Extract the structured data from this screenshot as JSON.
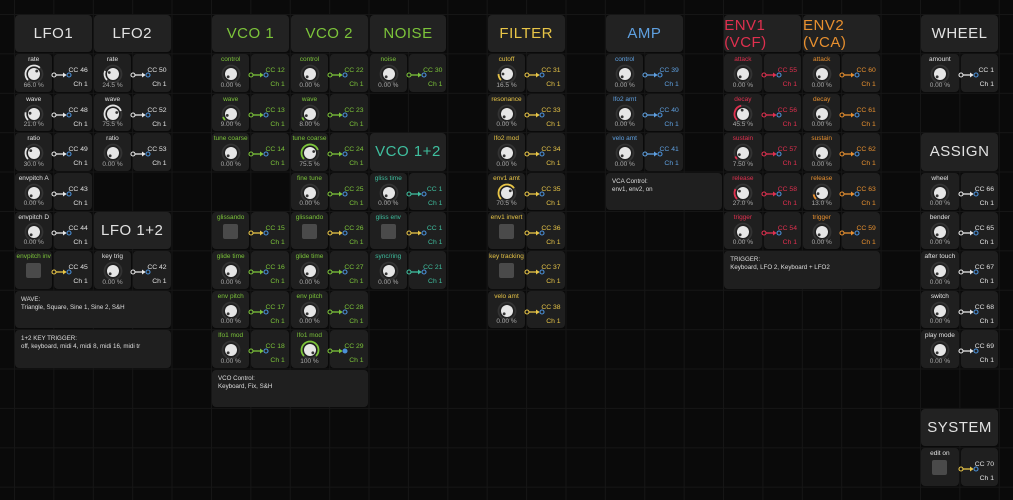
{
  "sections": {
    "lfo": {
      "color": "#e2e2e2",
      "headers": [
        {
          "title": "LFO1"
        },
        {
          "title": "LFO2"
        },
        {
          "title": "LFO 1+2"
        }
      ],
      "controls": [
        {
          "label": "rate",
          "type": "knob",
          "value": "66.0 %",
          "level": 0.66,
          "cc": "CC 46",
          "ch": "Ch 1"
        },
        {
          "label": "rate",
          "type": "knob",
          "value": "24.5 %",
          "level": 0.245,
          "cc": "CC 50",
          "ch": "Ch 1"
        },
        {
          "label": "wave",
          "type": "knob",
          "value": "21.0 %",
          "level": 0.21,
          "cc": "CC 48",
          "ch": "Ch 1"
        },
        {
          "label": "wave",
          "type": "knob",
          "value": "75.5 %",
          "level": 0.755,
          "cc": "CC 52",
          "ch": "Ch 1"
        },
        {
          "label": "ratio",
          "type": "knob",
          "value": "30.0 %",
          "level": 0.3,
          "cc": "CC 49",
          "ch": "Ch 1"
        },
        {
          "label": "ratio",
          "type": "knob",
          "value": "0.00 %",
          "level": 0,
          "cc": "CC 53",
          "ch": "Ch 1"
        },
        {
          "label": "envpitch A",
          "type": "knob",
          "value": "0.00 %",
          "level": 0,
          "cc": "CC 43",
          "ch": "Ch 1"
        },
        {
          "label": "envpitch D",
          "type": "knob",
          "value": "0.00 %",
          "level": 0,
          "cc": "CC 44",
          "ch": "Ch 1"
        },
        {
          "label": "envpitch inv",
          "type": "toggle",
          "label_color": "#7cc43a",
          "cc": "CC 45",
          "ch": "Ch 1"
        },
        {
          "label": "key trig",
          "type": "knob",
          "value": "0.00 %",
          "level": 0,
          "cc": "CC 42",
          "ch": "Ch 1"
        }
      ],
      "notes": [
        {
          "title": "WAVE:",
          "body": "Triangle, Square, Sine 1, Sine 2, S&H"
        },
        {
          "title": "1+2 KEY TRIGGER:",
          "body": "off, keyboard, midi 4, midi 8, midi 16, midi tr"
        }
      ]
    },
    "vco": {
      "color": "#7cc43a",
      "headers": [
        {
          "title": "VCO 1"
        },
        {
          "title": "VCO 2"
        },
        {
          "title": "NOISE"
        },
        {
          "title": "VCO 1+2",
          "color": "#3fbf9f"
        }
      ],
      "controls": [
        {
          "label": "control",
          "type": "knob",
          "value": "0.00 %",
          "level": 0,
          "cc": "CC 12",
          "ch": "Ch 1"
        },
        {
          "label": "control",
          "type": "knob",
          "value": "0.00 %",
          "level": 0,
          "cc": "CC 22",
          "ch": "Ch 1"
        },
        {
          "label": "noise",
          "type": "knob",
          "value": "0.00 %",
          "level": 0,
          "cc": "CC 30",
          "ch": "Ch 1"
        },
        {
          "label": "wave",
          "type": "knob",
          "value": "9.00 %",
          "level": 0.09,
          "cc": "CC 13",
          "ch": "Ch 1"
        },
        {
          "label": "wave",
          "type": "knob",
          "value": "8.00 %",
          "level": 0.08,
          "cc": "CC 23",
          "ch": "Ch 1"
        },
        {
          "label": "tune coarse",
          "type": "knob",
          "value": "0.00 %",
          "level": 0,
          "cc": "CC 14",
          "ch": "Ch 1"
        },
        {
          "label": "tune coarse",
          "type": "knob",
          "value": "75.5 %",
          "level": 0.755,
          "cc": "CC 24",
          "ch": "Ch 1"
        },
        {
          "label": "fine tune",
          "type": "knob",
          "value": "0.00 %",
          "level": 0,
          "cc": "CC 25",
          "ch": "Ch 1"
        },
        {
          "label": "gliss time",
          "type": "knob",
          "value": "0.00 %",
          "level": 0,
          "cc": "CC 1",
          "ch": "Ch 1",
          "color": "#3fbf9f"
        },
        {
          "label": "glissando",
          "type": "toggle",
          "cc": "CC 15",
          "ch": "Ch 1"
        },
        {
          "label": "glissando",
          "type": "toggle",
          "cc": "CC 26",
          "ch": "Ch 1"
        },
        {
          "label": "gliss env",
          "type": "toggle",
          "cc": "CC 1",
          "ch": "Ch 1",
          "color": "#3fbf9f"
        },
        {
          "label": "glide time",
          "type": "knob",
          "value": "0.00 %",
          "level": 0,
          "cc": "CC 16",
          "ch": "Ch 1"
        },
        {
          "label": "glide time",
          "type": "knob",
          "value": "0.00 %",
          "level": 0,
          "cc": "CC 27",
          "ch": "Ch 1"
        },
        {
          "label": "sync/ring",
          "type": "knob",
          "value": "0.00 %",
          "level": 0,
          "cc": "CC 21",
          "ch": "Ch 1",
          "color": "#3fbf9f"
        },
        {
          "label": "env pitch",
          "type": "knob",
          "value": "0.00 %",
          "level": 0,
          "cc": "CC 17",
          "ch": "Ch 1"
        },
        {
          "label": "env pitch",
          "type": "knob",
          "value": "0.00 %",
          "level": 0,
          "cc": "CC 28",
          "ch": "Ch 1"
        },
        {
          "label": "lfo1 mod",
          "type": "knob",
          "value": "0.00 %",
          "level": 0,
          "cc": "CC 18",
          "ch": "Ch 1"
        },
        {
          "label": "lfo1 mod",
          "type": "knob",
          "value": "100 %",
          "level": 1,
          "cc": "CC 29",
          "ch": "Ch 1"
        }
      ],
      "notes": [
        {
          "title": "VCO Control:",
          "body": "Keyboard, Fix, S&H"
        }
      ]
    },
    "filter": {
      "color": "#e8c547",
      "headers": [
        {
          "title": "FILTER"
        }
      ],
      "controls": [
        {
          "label": "cutoff",
          "type": "knob",
          "value": "16.5 %",
          "level": 0.165,
          "cc": "CC 31",
          "ch": "Ch 1"
        },
        {
          "label": "resonance",
          "type": "knob",
          "value": "0.00 %",
          "level": 0,
          "cc": "CC 33",
          "ch": "Ch 1"
        },
        {
          "label": "lfo2 mod",
          "type": "knob",
          "value": "0.00 %",
          "level": 0,
          "cc": "CC 34",
          "ch": "Ch 1"
        },
        {
          "label": "env1 amt",
          "type": "knob",
          "value": "70.5 %",
          "level": 0.705,
          "cc": "CC 35",
          "ch": "Ch 1"
        },
        {
          "label": "env1 invert",
          "type": "toggle",
          "cc": "CC 36",
          "ch": "Ch 1"
        },
        {
          "label": "key tracking",
          "type": "toggle",
          "cc": "CC 37",
          "ch": "Ch 1"
        },
        {
          "label": "velo amt",
          "type": "knob",
          "value": "0.00 %",
          "level": 0,
          "cc": "CC 38",
          "ch": "Ch 1"
        }
      ],
      "notes": []
    },
    "amp": {
      "color": "#5fa0e0",
      "headers": [
        {
          "title": "AMP"
        }
      ],
      "controls": [
        {
          "label": "control",
          "type": "knob",
          "value": "0.00 %",
          "level": 0,
          "cc": "CC 39",
          "ch": "Ch 1"
        },
        {
          "label": "lfo2 amt",
          "type": "knob",
          "value": "0.00 %",
          "level": 0,
          "cc": "CC 40",
          "ch": "Ch 1"
        },
        {
          "label": "velo amt",
          "type": "knob",
          "value": "0.00 %",
          "level": 0,
          "cc": "CC 41",
          "ch": "Ch 1"
        }
      ],
      "notes": [
        {
          "title": "VCA Control:",
          "body": "env1, env2, on"
        }
      ]
    },
    "env": {
      "color": "#e0304f",
      "headers": [
        {
          "title": "ENV1 (VCF)"
        },
        {
          "title": "ENV2 (VCA)",
          "color": "#e8902f"
        }
      ],
      "controls": [
        {
          "label": "attack",
          "type": "knob",
          "value": "0.00 %",
          "level": 0,
          "cc": "CC 55",
          "ch": "Ch 1"
        },
        {
          "label": "attack",
          "type": "knob",
          "value": "0.00 %",
          "level": 0,
          "cc": "CC 60",
          "ch": "Ch 1",
          "color": "#e8902f"
        },
        {
          "label": "decay",
          "type": "knob",
          "value": "45.5 %",
          "level": 0.455,
          "cc": "CC 56",
          "ch": "Ch 1"
        },
        {
          "label": "decay",
          "type": "knob",
          "value": "0.00 %",
          "level": 0,
          "cc": "CC 61",
          "ch": "Ch 1",
          "color": "#e8902f"
        },
        {
          "label": "sustain",
          "type": "knob",
          "value": "7.50 %",
          "level": 0.075,
          "cc": "CC 57",
          "ch": "Ch 1"
        },
        {
          "label": "sustain",
          "type": "knob",
          "value": "0.00 %",
          "level": 0,
          "cc": "CC 62",
          "ch": "Ch 1",
          "color": "#e8902f"
        },
        {
          "label": "release",
          "type": "knob",
          "value": "27.0 %",
          "level": 0.27,
          "cc": "CC 58",
          "ch": "Ch 1"
        },
        {
          "label": "release",
          "type": "knob",
          "value": "13.0 %",
          "level": 0.13,
          "cc": "CC 63",
          "ch": "Ch 1",
          "color": "#e8902f"
        },
        {
          "label": "trigger",
          "type": "knob",
          "value": "0.00 %",
          "level": 0,
          "cc": "CC 54",
          "ch": "Ch 1"
        },
        {
          "label": "trigger",
          "type": "knob",
          "value": "0.00 %",
          "level": 0,
          "cc": "CC 59",
          "ch": "Ch 1",
          "color": "#e8902f"
        }
      ],
      "notes": [
        {
          "title": "TRIGGER:",
          "body": "Keyboard, LFO 2, Keyboard + LFO2"
        }
      ]
    },
    "wheel": {
      "color": "#e2e2e2",
      "headers": [
        {
          "title": "WHEEL"
        },
        {
          "title": "ASSIGN"
        },
        {
          "title": "SYSTEM"
        }
      ],
      "controls": [
        {
          "label": "amount",
          "type": "knob",
          "value": "0.00 %",
          "level": 0,
          "cc": "CC 1",
          "ch": "Ch 1"
        },
        {
          "label": "wheel",
          "type": "knob",
          "value": "0.00 %",
          "level": 0,
          "cc": "CC 66",
          "ch": "Ch 1"
        },
        {
          "label": "bender",
          "type": "knob",
          "value": "0.00 %",
          "level": 0,
          "cc": "CC 65",
          "ch": "Ch 1"
        },
        {
          "label": "after touch",
          "type": "knob",
          "value": "0.00 %",
          "level": 0,
          "cc": "CC 67",
          "ch": "Ch 1"
        },
        {
          "label": "switch",
          "type": "knob",
          "value": "0.00 %",
          "level": 0,
          "cc": "CC 68",
          "ch": "Ch 1"
        },
        {
          "label": "play mode",
          "type": "knob",
          "value": "0.00 %",
          "level": 0,
          "cc": "CC 69",
          "ch": "Ch 1"
        },
        {
          "label": "edit on",
          "type": "toggle",
          "cc": "CC 70",
          "ch": "Ch 1"
        }
      ],
      "notes": []
    }
  },
  "colors": {
    "toggle_connector": "#e8c547",
    "port": "#4a90d9"
  }
}
